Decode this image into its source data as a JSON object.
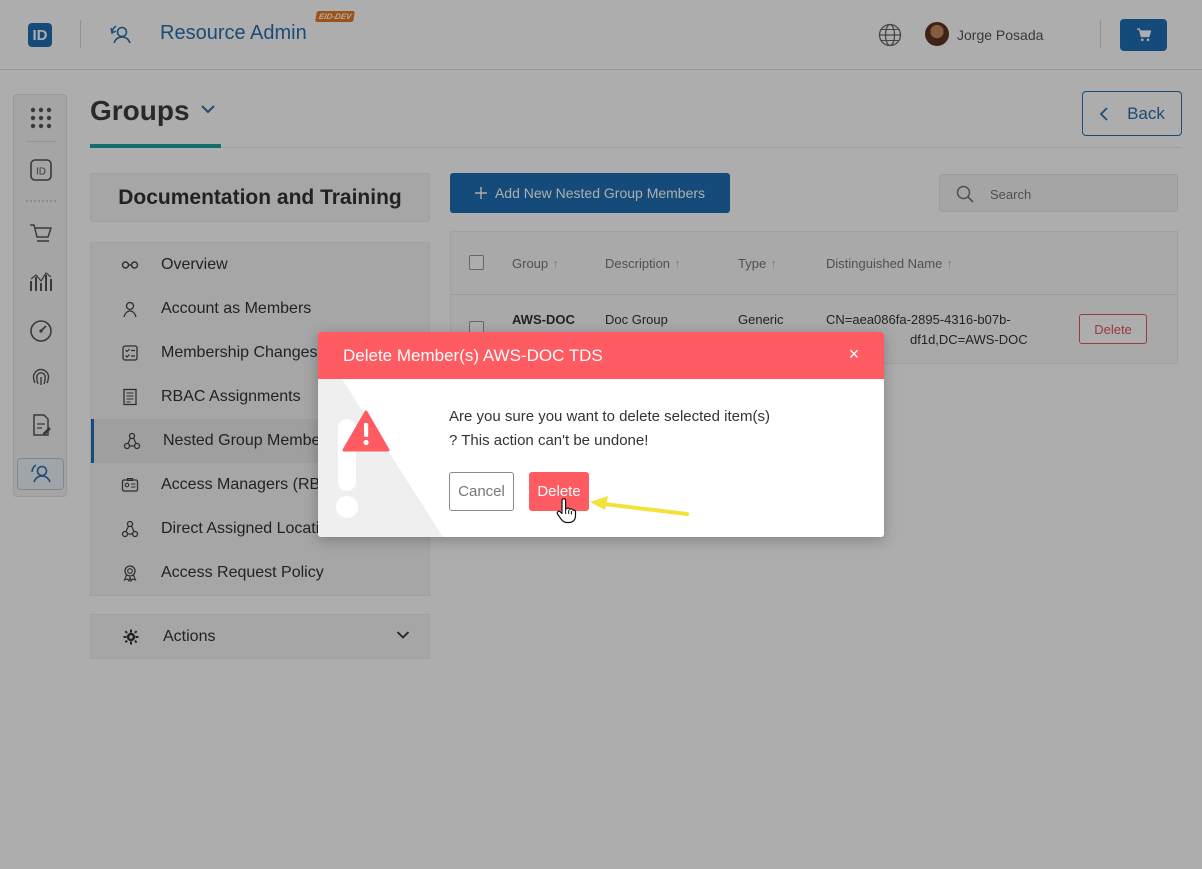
{
  "header": {
    "logo_text": "ID",
    "app_title": "Resource Admin",
    "env_badge": "EID-DEV",
    "user_name": "Jorge Posada",
    "icons": {
      "app": "admin-user-icon",
      "globe": "globe-icon",
      "cart": "cart-icon"
    }
  },
  "rail": {
    "items": [
      "apps-grid-icon",
      "id-card-icon",
      "cart-icon",
      "analytics-icon",
      "dashboard-gauge-icon",
      "fingerprint-icon",
      "edit-document-icon",
      "admin-user-icon"
    ]
  },
  "page": {
    "title": "Groups",
    "back_label": "Back"
  },
  "left_panel": {
    "group_name": "Documentation and Training",
    "nav": [
      {
        "label": "Overview",
        "icon": "glasses-icon"
      },
      {
        "label": "Account as Members",
        "icon": "person-icon"
      },
      {
        "label": "Membership Changes",
        "icon": "checklist-icon"
      },
      {
        "label": "RBAC Assignments",
        "icon": "document-list-icon"
      },
      {
        "label": "Nested Group Members",
        "icon": "hierarchy-icon"
      },
      {
        "label": "Access Managers (RBAC)",
        "icon": "id-badge-icon"
      },
      {
        "label": "Direct Assigned Locations",
        "icon": "hierarchy-icon"
      },
      {
        "label": "Access Request Policy",
        "icon": "award-icon"
      }
    ],
    "active_index": 4,
    "actions_label": "Actions"
  },
  "content": {
    "add_button_label": "Add New Nested Group Members",
    "search_placeholder": "Search",
    "table": {
      "headers": [
        "Group",
        "Description",
        "Type",
        "Distinguished Name"
      ],
      "rows": [
        {
          "group": "AWS-DOC",
          "description": "Doc Group",
          "type": "Generic",
          "dn_line1": "CN=aea086fa-2895-4316-b07b-",
          "dn_line2": "df1d,DC=AWS-DOC",
          "delete_label": "Delete"
        }
      ]
    }
  },
  "modal": {
    "title": "Delete Member(s) AWS-DOC TDS",
    "message": "Are you sure you want to delete selected item(s) ? This action can't be undone!",
    "cancel_label": "Cancel",
    "delete_label": "Delete",
    "close_glyph": "×"
  },
  "colors": {
    "primary": "#1f6fb5",
    "accent_underline": "#1ea4a0",
    "danger": "#fe5b62",
    "danger_outline": "#e0575b",
    "annotation_arrow": "#f2e23a"
  }
}
